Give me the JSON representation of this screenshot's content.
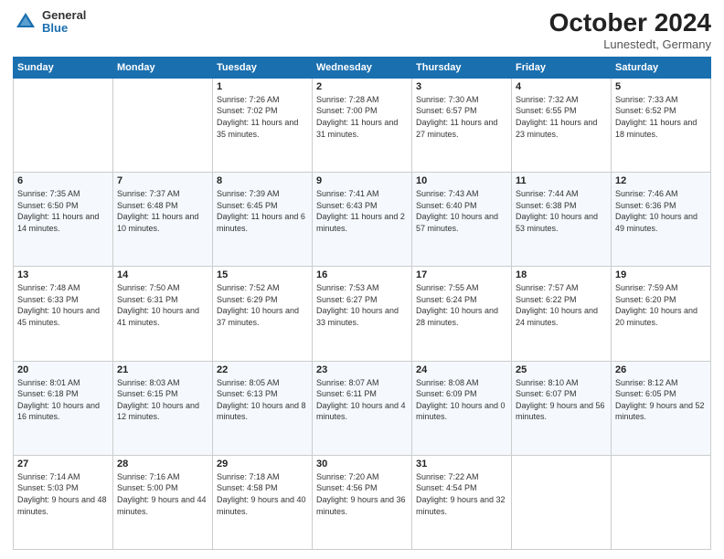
{
  "header": {
    "logo_general": "General",
    "logo_blue": "Blue",
    "month_title": "October 2024",
    "location": "Lunestedt, Germany"
  },
  "weekdays": [
    "Sunday",
    "Monday",
    "Tuesday",
    "Wednesday",
    "Thursday",
    "Friday",
    "Saturday"
  ],
  "weeks": [
    [
      {
        "day": "",
        "content": ""
      },
      {
        "day": "",
        "content": ""
      },
      {
        "day": "1",
        "content": "Sunrise: 7:26 AM\nSunset: 7:02 PM\nDaylight: 11 hours and 35 minutes."
      },
      {
        "day": "2",
        "content": "Sunrise: 7:28 AM\nSunset: 7:00 PM\nDaylight: 11 hours and 31 minutes."
      },
      {
        "day": "3",
        "content": "Sunrise: 7:30 AM\nSunset: 6:57 PM\nDaylight: 11 hours and 27 minutes."
      },
      {
        "day": "4",
        "content": "Sunrise: 7:32 AM\nSunset: 6:55 PM\nDaylight: 11 hours and 23 minutes."
      },
      {
        "day": "5",
        "content": "Sunrise: 7:33 AM\nSunset: 6:52 PM\nDaylight: 11 hours and 18 minutes."
      }
    ],
    [
      {
        "day": "6",
        "content": "Sunrise: 7:35 AM\nSunset: 6:50 PM\nDaylight: 11 hours and 14 minutes."
      },
      {
        "day": "7",
        "content": "Sunrise: 7:37 AM\nSunset: 6:48 PM\nDaylight: 11 hours and 10 minutes."
      },
      {
        "day": "8",
        "content": "Sunrise: 7:39 AM\nSunset: 6:45 PM\nDaylight: 11 hours and 6 minutes."
      },
      {
        "day": "9",
        "content": "Sunrise: 7:41 AM\nSunset: 6:43 PM\nDaylight: 11 hours and 2 minutes."
      },
      {
        "day": "10",
        "content": "Sunrise: 7:43 AM\nSunset: 6:40 PM\nDaylight: 10 hours and 57 minutes."
      },
      {
        "day": "11",
        "content": "Sunrise: 7:44 AM\nSunset: 6:38 PM\nDaylight: 10 hours and 53 minutes."
      },
      {
        "day": "12",
        "content": "Sunrise: 7:46 AM\nSunset: 6:36 PM\nDaylight: 10 hours and 49 minutes."
      }
    ],
    [
      {
        "day": "13",
        "content": "Sunrise: 7:48 AM\nSunset: 6:33 PM\nDaylight: 10 hours and 45 minutes."
      },
      {
        "day": "14",
        "content": "Sunrise: 7:50 AM\nSunset: 6:31 PM\nDaylight: 10 hours and 41 minutes."
      },
      {
        "day": "15",
        "content": "Sunrise: 7:52 AM\nSunset: 6:29 PM\nDaylight: 10 hours and 37 minutes."
      },
      {
        "day": "16",
        "content": "Sunrise: 7:53 AM\nSunset: 6:27 PM\nDaylight: 10 hours and 33 minutes."
      },
      {
        "day": "17",
        "content": "Sunrise: 7:55 AM\nSunset: 6:24 PM\nDaylight: 10 hours and 28 minutes."
      },
      {
        "day": "18",
        "content": "Sunrise: 7:57 AM\nSunset: 6:22 PM\nDaylight: 10 hours and 24 minutes."
      },
      {
        "day": "19",
        "content": "Sunrise: 7:59 AM\nSunset: 6:20 PM\nDaylight: 10 hours and 20 minutes."
      }
    ],
    [
      {
        "day": "20",
        "content": "Sunrise: 8:01 AM\nSunset: 6:18 PM\nDaylight: 10 hours and 16 minutes."
      },
      {
        "day": "21",
        "content": "Sunrise: 8:03 AM\nSunset: 6:15 PM\nDaylight: 10 hours and 12 minutes."
      },
      {
        "day": "22",
        "content": "Sunrise: 8:05 AM\nSunset: 6:13 PM\nDaylight: 10 hours and 8 minutes."
      },
      {
        "day": "23",
        "content": "Sunrise: 8:07 AM\nSunset: 6:11 PM\nDaylight: 10 hours and 4 minutes."
      },
      {
        "day": "24",
        "content": "Sunrise: 8:08 AM\nSunset: 6:09 PM\nDaylight: 10 hours and 0 minutes."
      },
      {
        "day": "25",
        "content": "Sunrise: 8:10 AM\nSunset: 6:07 PM\nDaylight: 9 hours and 56 minutes."
      },
      {
        "day": "26",
        "content": "Sunrise: 8:12 AM\nSunset: 6:05 PM\nDaylight: 9 hours and 52 minutes."
      }
    ],
    [
      {
        "day": "27",
        "content": "Sunrise: 7:14 AM\nSunset: 5:03 PM\nDaylight: 9 hours and 48 minutes."
      },
      {
        "day": "28",
        "content": "Sunrise: 7:16 AM\nSunset: 5:00 PM\nDaylight: 9 hours and 44 minutes."
      },
      {
        "day": "29",
        "content": "Sunrise: 7:18 AM\nSunset: 4:58 PM\nDaylight: 9 hours and 40 minutes."
      },
      {
        "day": "30",
        "content": "Sunrise: 7:20 AM\nSunset: 4:56 PM\nDaylight: 9 hours and 36 minutes."
      },
      {
        "day": "31",
        "content": "Sunrise: 7:22 AM\nSunset: 4:54 PM\nDaylight: 9 hours and 32 minutes."
      },
      {
        "day": "",
        "content": ""
      },
      {
        "day": "",
        "content": ""
      }
    ]
  ]
}
